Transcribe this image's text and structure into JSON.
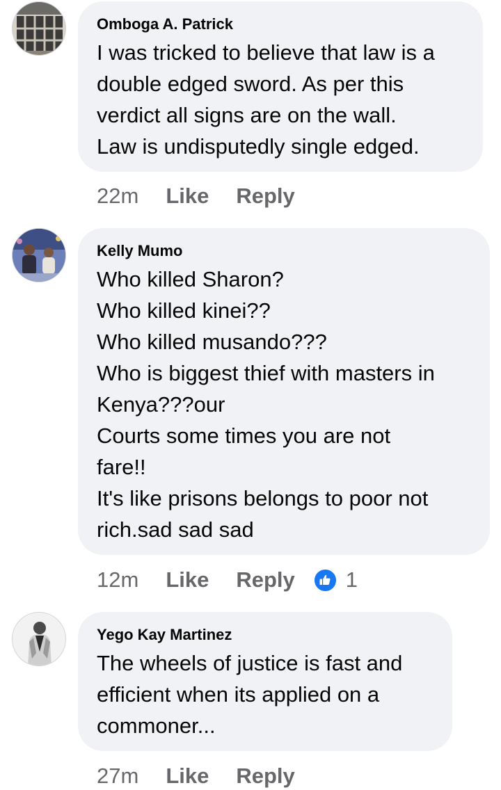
{
  "comments": [
    {
      "author": "Omboga A. Patrick",
      "avatar_icon": "profile-photo-window",
      "lines": [
        "I was tricked to believe that law is a",
        "double edged sword. As per this",
        "verdict all signs are on the wall.",
        "Law is undisputedly single edged."
      ],
      "time": "22m",
      "like_label": "Like",
      "reply_label": "Reply"
    },
    {
      "author": "Kelly Mumo",
      "avatar_icon": "profile-photo-group",
      "lines": [
        "Who killed Sharon?",
        "Who killed kinei??",
        "Who killed musando???",
        "Who is biggest thief with masters in",
        "Kenya???our",
        "Courts some times you are not",
        "fare!!",
        "It's like prisons belongs to poor not",
        "rich.sad sad sad"
      ],
      "time": "12m",
      "like_label": "Like",
      "reply_label": "Reply",
      "reaction_icon": "thumbs-up-icon",
      "reaction_count": "1"
    },
    {
      "author": "Yego Kay Martinez",
      "avatar_icon": "profile-photo-person",
      "lines": [
        "The wheels of justice is fast and",
        "efficient when its applied on a",
        "commoner..."
      ],
      "time": "27m",
      "like_label": "Like",
      "reply_label": "Reply"
    }
  ],
  "colors": {
    "bubble": "#f0f2f5",
    "meta_text": "#65676b",
    "body_text": "#050505",
    "like_accent": "#1877f2"
  }
}
